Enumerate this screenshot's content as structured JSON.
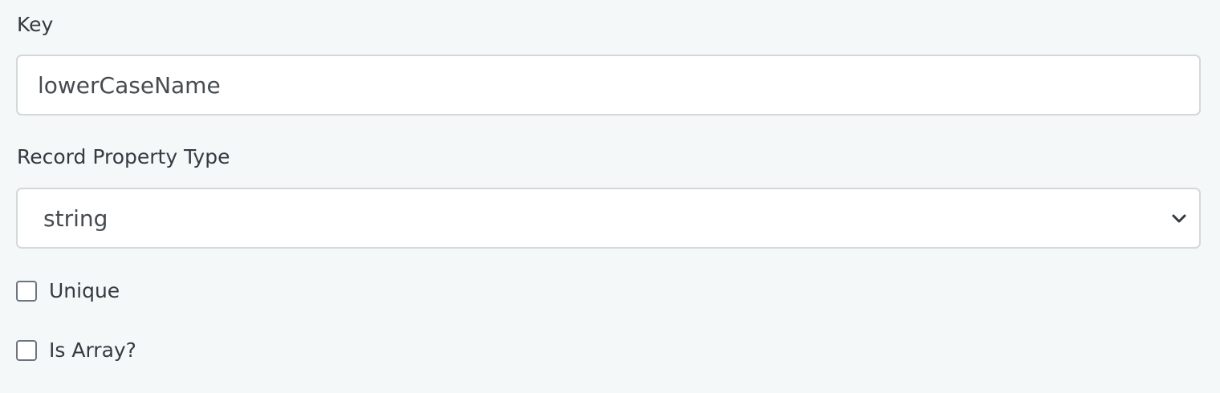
{
  "form": {
    "key": {
      "label": "Key",
      "value": "lowerCaseName"
    },
    "record_property_type": {
      "label": "Record Property Type",
      "selected": "string",
      "icon": "chevron-down-icon"
    },
    "unique": {
      "label": "Unique",
      "checked": false
    },
    "is_array": {
      "label": "Is Array?",
      "checked": false
    }
  },
  "colors": {
    "background": "#f5f8f9",
    "field_background": "#ffffff",
    "field_border": "#d3d8dc",
    "text": "#343a40"
  }
}
